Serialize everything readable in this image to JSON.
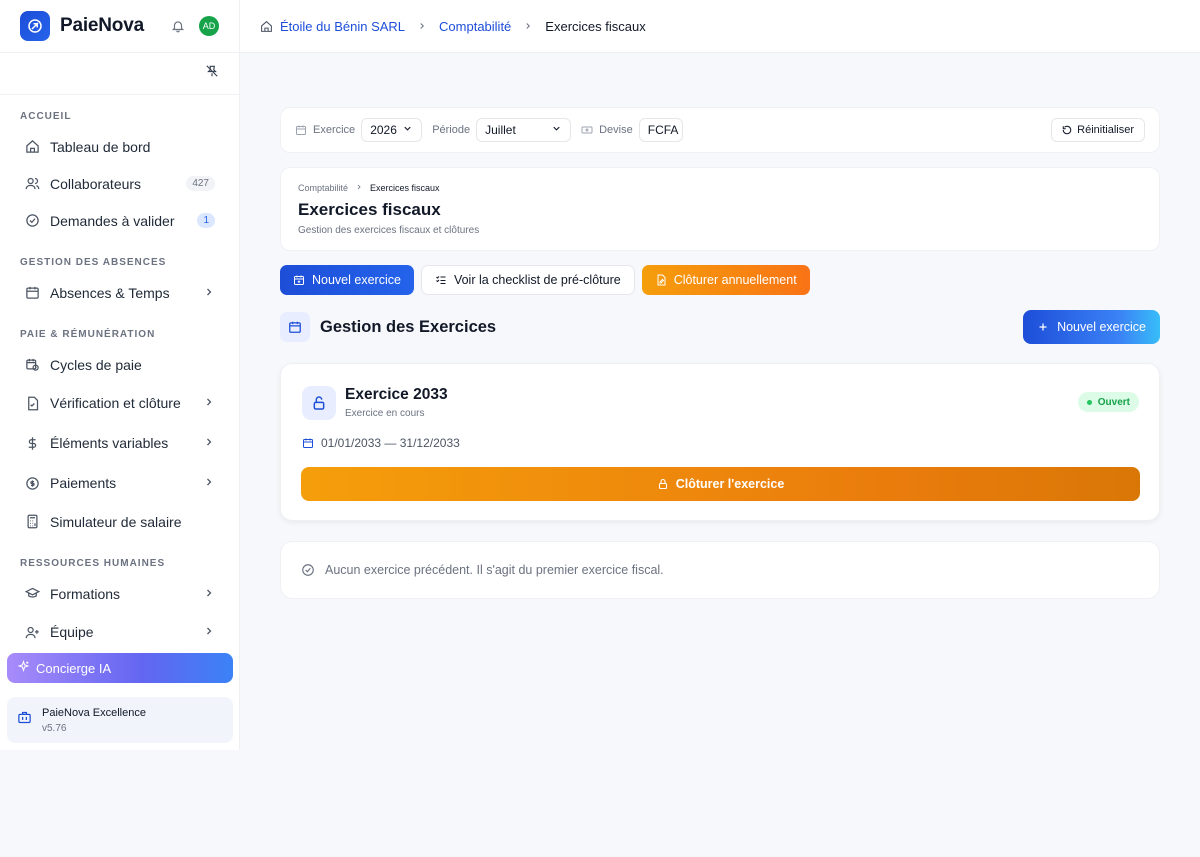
{
  "brand": {
    "name": "PaieNova",
    "avatar": "AD"
  },
  "sidebar": {
    "sections": [
      {
        "title": "ACCUEIL"
      },
      {
        "title": "GESTION DES ABSENCES"
      },
      {
        "title": "PAIE & RÉMUNÉRATION"
      },
      {
        "title": "RESSOURCES HUMAINES"
      }
    ],
    "items": [
      {
        "label": "Tableau de bord",
        "icon": "home-icon"
      },
      {
        "label": "Collaborateurs",
        "icon": "users-icon",
        "badge": "427"
      },
      {
        "label": "Demandes à valider",
        "icon": "check-circle-icon",
        "badge": "1"
      },
      {
        "label": "Absences & Temps",
        "icon": "calendar-icon"
      },
      {
        "label": "Cycles de paie",
        "icon": "calendar-clock-icon"
      },
      {
        "label": "Vérification et clôture",
        "icon": "file-check-icon"
      },
      {
        "label": "Éléments variables",
        "icon": "dollar-icon"
      },
      {
        "label": "Paiements",
        "icon": "coin-icon"
      },
      {
        "label": "Simulateur de salaire",
        "icon": "calculator-icon"
      },
      {
        "label": "Formations",
        "icon": "graduation-cap-icon"
      },
      {
        "label": "Équipe",
        "icon": "user-plus-icon"
      }
    ],
    "concierge": "Concierge IA",
    "version_card": {
      "title": "PaieNova Excellence",
      "version": "v5.76"
    }
  },
  "topbar": {
    "crumbs": [
      "Étoile du Bénin SARL",
      "Comptabilité",
      "Exercices fiscaux"
    ]
  },
  "filters": {
    "exercice_label": "Exercice",
    "exercice_value": "2026",
    "periode_label": "Période",
    "periode_value": "Juillet",
    "devise_label": "Devise",
    "devise_value": "FCFA",
    "reset_label": "Réinitialiser"
  },
  "header": {
    "crumbs": [
      "Comptabilité",
      "Exercices fiscaux"
    ],
    "title": "Exercices fiscaux",
    "subtitle": "Gestion des exercices fiscaux et clôtures"
  },
  "actions": {
    "new_label": "Nouvel exercice",
    "checklist_label": "Voir la checklist de pré-clôture",
    "close_year_label": "Clôturer annuellement"
  },
  "section": {
    "title": "Gestion des Exercices",
    "new_button": "Nouvel exercice"
  },
  "exercise": {
    "title": "Exercice 2033",
    "subtitle": "Exercice en cours",
    "status": "Ouvert",
    "dates": "01/01/2033 — 31/12/2033",
    "close_button": "Clôturer l'exercice"
  },
  "empty_message": "Aucun exercice précédent. Il s'agit du premier exercice fiscal.",
  "colors": {
    "primary": "#1d4ed8",
    "orange": "#f59e0b",
    "success": "#16a34a"
  }
}
